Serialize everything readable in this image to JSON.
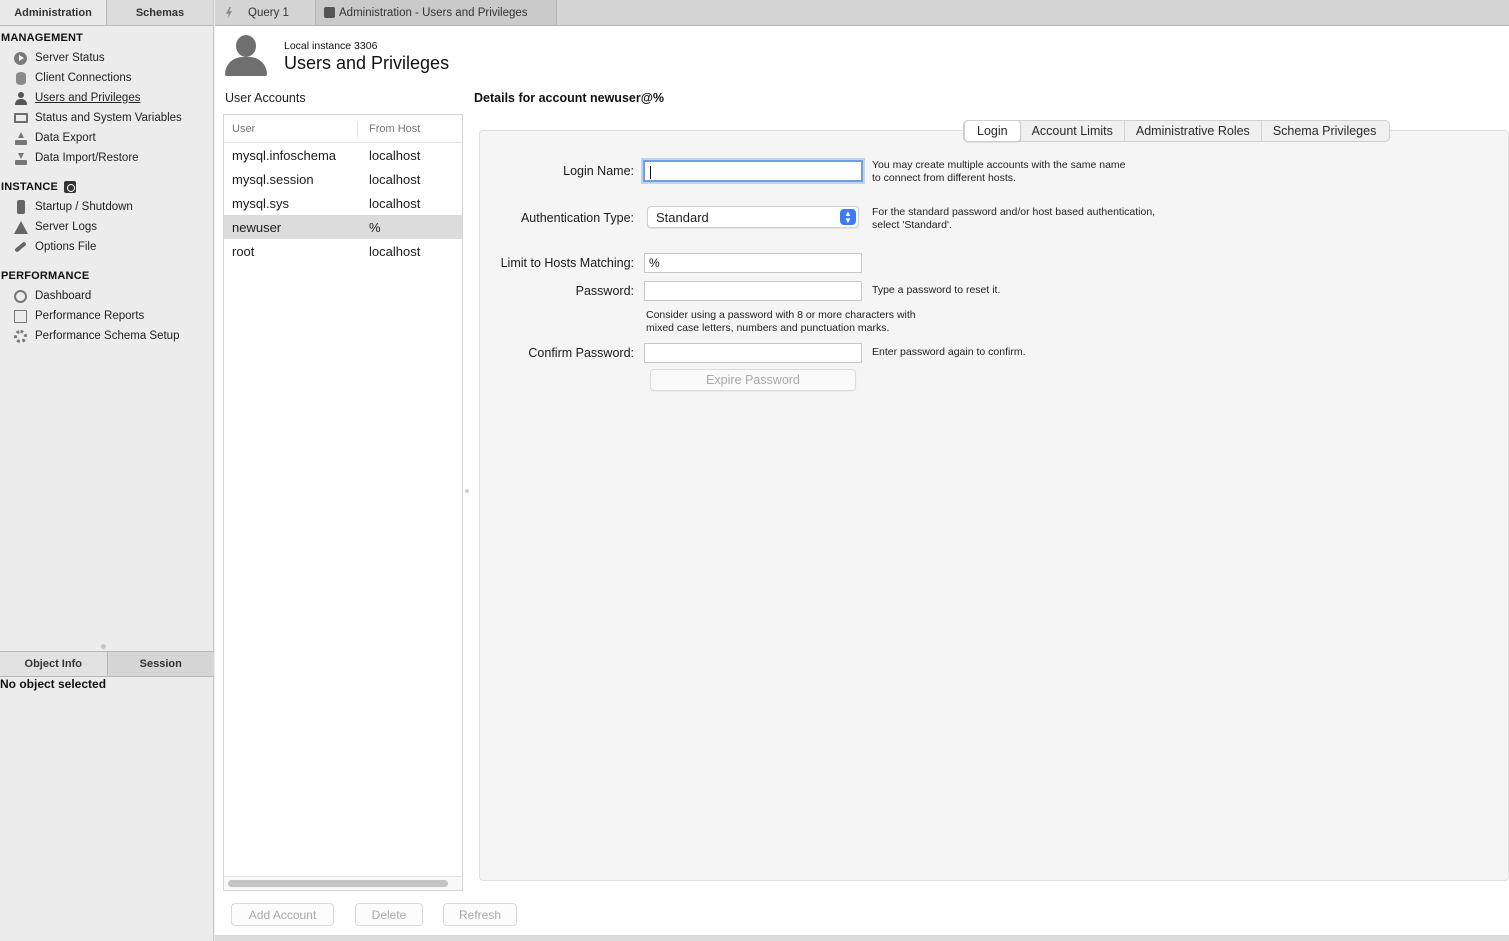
{
  "sidebar": {
    "tabs": [
      {
        "label": "Administration"
      },
      {
        "label": "Schemas"
      }
    ],
    "sections": {
      "management": {
        "title": "MANAGEMENT",
        "items": [
          {
            "label": "Server Status",
            "icon": "server-status-icon"
          },
          {
            "label": "Client Connections",
            "icon": "database-icon"
          },
          {
            "label": "Users and Privileges",
            "icon": "user-icon",
            "selected": true
          },
          {
            "label": "Status and System Variables",
            "icon": "monitor-icon"
          },
          {
            "label": "Data Export",
            "icon": "export-icon"
          },
          {
            "label": "Data Import/Restore",
            "icon": "import-icon"
          }
        ]
      },
      "instance": {
        "title": "INSTANCE",
        "items": [
          {
            "label": "Startup / Shutdown",
            "icon": "switch-icon"
          },
          {
            "label": "Server Logs",
            "icon": "warning-icon"
          },
          {
            "label": "Options File",
            "icon": "wrench-icon"
          }
        ]
      },
      "performance": {
        "title": "PERFORMANCE",
        "items": [
          {
            "label": "Dashboard",
            "icon": "gauge-icon"
          },
          {
            "label": "Performance Reports",
            "icon": "report-icon"
          },
          {
            "label": "Performance Schema Setup",
            "icon": "gear-icon"
          }
        ]
      }
    },
    "bottom_tabs": [
      {
        "label": "Object Info"
      },
      {
        "label": "Session"
      }
    ],
    "object_info": "No object selected"
  },
  "top_tabs": [
    {
      "label": "Query 1",
      "icon": "lightning-icon"
    },
    {
      "label": "Administration - Users and Privileges",
      "icon": "puzzle-icon",
      "active": true
    }
  ],
  "header": {
    "instance": "Local instance 3306",
    "title": "Users and Privileges"
  },
  "user_accounts": {
    "label": "User Accounts",
    "columns": [
      "User",
      "From Host"
    ],
    "rows": [
      {
        "user": "mysql.infoschema",
        "host": "localhost"
      },
      {
        "user": "mysql.session",
        "host": "localhost"
      },
      {
        "user": "mysql.sys",
        "host": "localhost"
      },
      {
        "user": "newuser",
        "host": "%",
        "selected": true
      },
      {
        "user": "root",
        "host": "localhost"
      }
    ]
  },
  "buttons": {
    "add_account": "Add Account",
    "delete": "Delete",
    "refresh": "Refresh"
  },
  "details": {
    "title": "Details for account newuser@%",
    "tabs": [
      "Login",
      "Account Limits",
      "Administrative Roles",
      "Schema Privileges"
    ],
    "active_tab": "Login",
    "form": {
      "login_name": {
        "label": "Login Name:",
        "value": "",
        "hint": [
          "You may create multiple accounts with the same name",
          "to connect from different hosts."
        ]
      },
      "auth_type": {
        "label": "Authentication Type:",
        "value": "Standard",
        "hint": [
          "For the standard password and/or host based authentication,",
          "select 'Standard'."
        ]
      },
      "hosts": {
        "label": "Limit to Hosts Matching:",
        "value": "%"
      },
      "password": {
        "label": "Password:",
        "value": "",
        "hint": [
          "Type a password to reset it."
        ],
        "advice": [
          "Consider using a password with 8 or more characters with",
          "mixed case letters, numbers and punctuation marks."
        ]
      },
      "confirm": {
        "label": "Confirm Password:",
        "value": "",
        "hint": [
          "Enter password again to confirm."
        ]
      },
      "expire_button": "Expire Password"
    }
  },
  "colors": {
    "accent": "#3b7cf5",
    "focus_ring": "#6f9fe0",
    "selected_row": "#dcdcdc"
  }
}
